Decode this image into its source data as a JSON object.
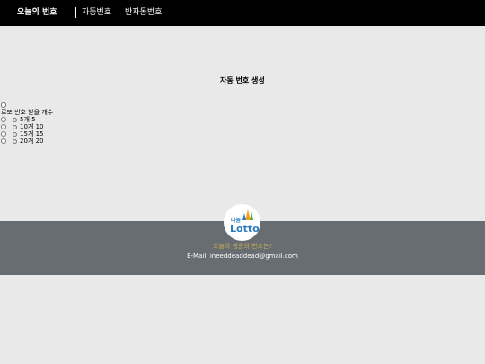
{
  "header": {
    "brand": "오늘의 번호",
    "nav": [
      {
        "label": "자동번호"
      },
      {
        "label": "반자동번호"
      }
    ]
  },
  "main": {
    "title": "자동 번호 생성",
    "count_label": "로또 번호 받을 개수",
    "options": [
      {
        "label": "5개 5"
      },
      {
        "label": "10개 10"
      },
      {
        "label": "15개 15"
      },
      {
        "label": "20개 20"
      }
    ]
  },
  "footer": {
    "logo_small": "나눔",
    "logo_text": "Lotto",
    "link": "오늘의 행운의 번호는?",
    "email": "E-Mail: ineeddeaddead@gmail.com"
  },
  "colors": {
    "topbar": "#000000",
    "background": "#e9e9e9",
    "footer": "#686d72",
    "footer_link": "#c8a95a"
  }
}
